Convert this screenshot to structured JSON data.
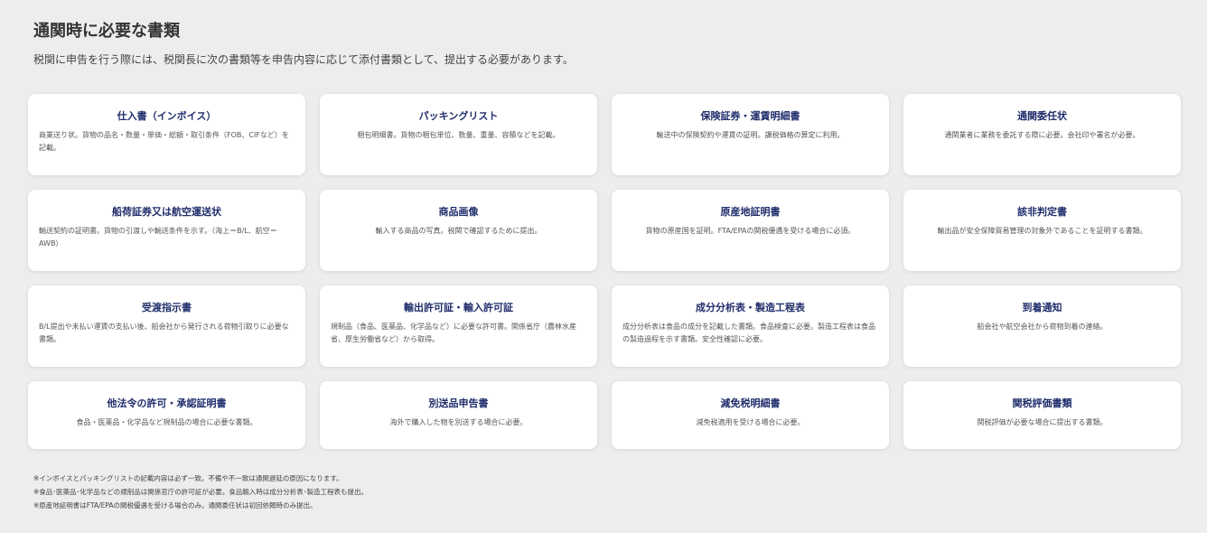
{
  "header": {
    "title": "通関時に必要な書類",
    "subtitle": "税関に申告を行う際には、税関長に次の書類等を申告内容に応じて添付書類として、提出する必要があります。"
  },
  "cards": [
    {
      "title": "仕入書（インボイス）",
      "desc": "商業送り状。貨物の品名・数量・単価・総額・取引条件（FOB、CIFなど）を記載。"
    },
    {
      "title": "パッキングリスト",
      "desc": "梱包明細書。貨物の梱包単位、数量、重量、容積などを記載。"
    },
    {
      "title": "保険証券・運賃明細書",
      "desc": "輸送中の保険契約や運賃の証明。課税価格の算定に利用。"
    },
    {
      "title": "通関委任状",
      "desc": "通関業者に業務を委託する際に必要。会社印や署名が必要。"
    },
    {
      "title": "船荷証券又は航空運送状",
      "desc": "輸送契約の証明書。貨物の引渡しや輸送条件を示す。（海上＝B/L、航空＝AWB）"
    },
    {
      "title": "商品画像",
      "desc": "輸入する商品の写真。税関で確認するために提出。"
    },
    {
      "title": "原産地証明書",
      "desc": "貨物の原産国を証明。FTA/EPAの関税優遇を受ける場合に必須。"
    },
    {
      "title": "該非判定書",
      "desc": "輸出品が安全保障貿易管理の対象外であることを証明する書類。"
    },
    {
      "title": "受渡指示書",
      "desc": "B/L提出や未払い運賃の支払い後、船会社から発行される荷物引取りに必要な書類。"
    },
    {
      "title": "輸出許可証・輸入許可証",
      "desc": "規制品（食品、医薬品、化学品など）に必要な許可書。関係省庁（農林水産省、厚生労働省など）から取得。"
    },
    {
      "title": "成分分析表・製造工程表",
      "desc": "成分分析表は食品の成分を記載した書類。食品検査に必要。製造工程表は食品の製造過程を示す書類。安全性確認に必要。"
    },
    {
      "title": "到着通知",
      "desc": "船会社や航空会社から荷物到着の連絡。"
    },
    {
      "title": "他法令の許可・承認証明書",
      "desc": "食品・医薬品・化学品など規制品の場合に必要な書類。"
    },
    {
      "title": "別送品申告書",
      "desc": "海外で購入した物を別送する場合に必要。"
    },
    {
      "title": "減免税明細書",
      "desc": "減免税適用を受ける場合に必要。"
    },
    {
      "title": "関税評価書類",
      "desc": "関税評価が必要な場合に提出する書類。"
    }
  ],
  "notes": [
    "※インボイスとパッキングリストの記載内容は必ず一致。不備や不一致は通関遅延の原因になります。",
    "※食品･医薬品･化学品などの規制品は関係官庁の許可証が必要。食品輸入時は成分分析表･製造工程表も提出。",
    "※原産地証明書はFTA/EPAの関税優遇を受ける場合のみ。通関委任状は初回依頼時のみ提出。"
  ]
}
